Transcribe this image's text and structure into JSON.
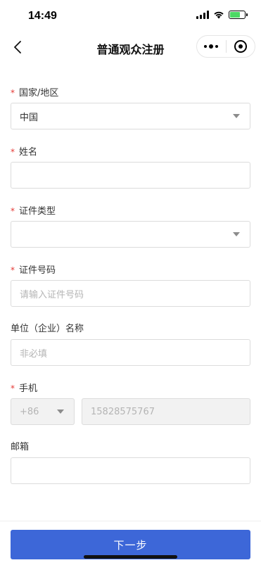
{
  "status_bar": {
    "time": "14:49"
  },
  "nav": {
    "title": "普通观众注册"
  },
  "form": {
    "country": {
      "required_mark": "*",
      "label": "国家/地区",
      "value": "中国"
    },
    "name": {
      "required_mark": "*",
      "label": "姓名",
      "value": ""
    },
    "id_type": {
      "required_mark": "*",
      "label": "证件类型",
      "value": ""
    },
    "id_number": {
      "required_mark": "*",
      "label": "证件号码",
      "placeholder": "请输入证件号码"
    },
    "company": {
      "label": "单位（企业）名称",
      "placeholder": "非必填"
    },
    "phone": {
      "required_mark": "*",
      "label": "手机",
      "country_code": "+86",
      "number": "15828575767"
    },
    "email": {
      "label": "邮箱",
      "value": ""
    }
  },
  "footer": {
    "next_label": "下一步"
  },
  "colors": {
    "primary": "#3d67d8",
    "required": "#e53935",
    "battery": "#4cd964"
  }
}
